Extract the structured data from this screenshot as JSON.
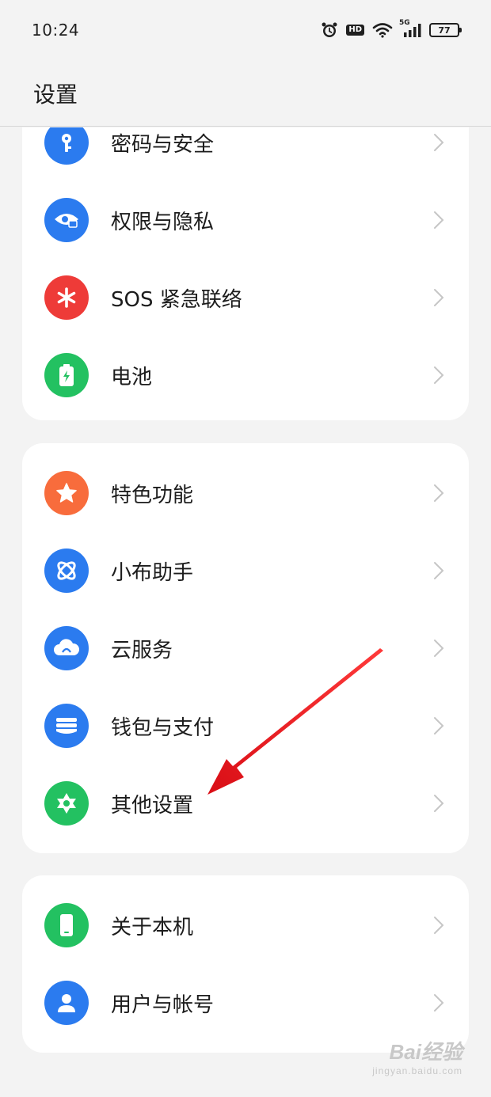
{
  "status_bar": {
    "time": "10:24",
    "hd_label": "HD",
    "network_label": "5G",
    "battery_level": "77"
  },
  "header": {
    "title": "设置"
  },
  "cards": [
    {
      "items": [
        {
          "label": "密码与安全",
          "icon": "key-icon",
          "color": "#2b7bef"
        },
        {
          "label": "权限与隐私",
          "icon": "privacy-eye-icon",
          "color": "#2b7bef"
        },
        {
          "label": "SOS 紧急联络",
          "icon": "asterisk-icon",
          "color": "#ee3b38"
        },
        {
          "label": "电池",
          "icon": "battery-icon",
          "color": "#23c161"
        }
      ]
    },
    {
      "items": [
        {
          "label": "特色功能",
          "icon": "star-icon",
          "color": "#f86c3c"
        },
        {
          "label": "小布助手",
          "icon": "assistant-icon",
          "color": "#2b7bef"
        },
        {
          "label": "云服务",
          "icon": "cloud-icon",
          "color": "#2b7bef"
        },
        {
          "label": "钱包与支付",
          "icon": "wallet-icon",
          "color": "#2b7bef"
        },
        {
          "label": "其他设置",
          "icon": "gear-icon",
          "color": "#23c161"
        }
      ]
    },
    {
      "items": [
        {
          "label": "关于本机",
          "icon": "phone-icon",
          "color": "#23c161"
        },
        {
          "label": "用户与帐号",
          "icon": "user-icon",
          "color": "#2b7bef"
        }
      ]
    }
  ],
  "watermark": {
    "main": "Bai经验",
    "sub": "jingyan.baidu.com"
  },
  "colors": {
    "arrow": "#e8141b",
    "background": "#f3f3f3",
    "card": "#ffffff"
  }
}
